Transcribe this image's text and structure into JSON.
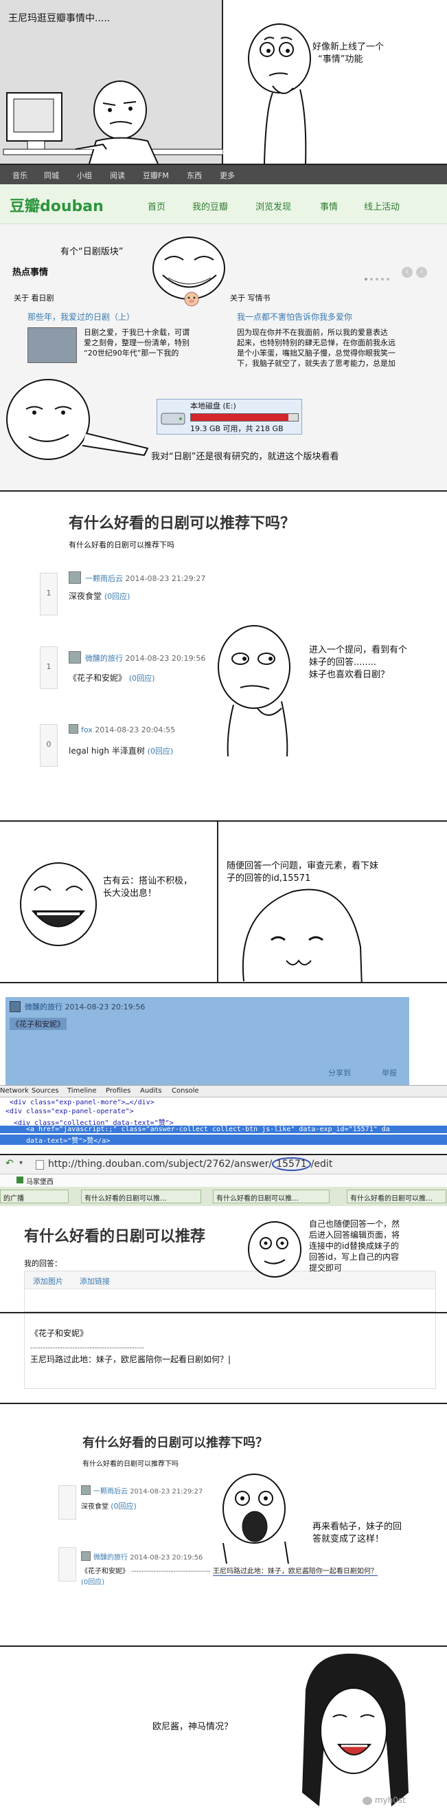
{
  "panel1": {
    "caption": "王尼玛逛豆瓣事情中.....",
    "thought": [
      "好像新上线了一个",
      "“事情”功能"
    ]
  },
  "douban": {
    "topnav": [
      "音乐",
      "同城",
      "小组",
      "阅读",
      "豆瓣FM",
      "东西",
      "更多"
    ],
    "logo": "豆瓣douban",
    "mainnav": [
      "首页",
      "我的豆瓣",
      "浏览发现",
      "事情",
      "线上活动"
    ],
    "bubble": "有个“日剧版块”",
    "hot_title": "热点事情",
    "left_tag": "关于 看日剧",
    "left_title": "那些年，我爱过的日剧（上）",
    "left_body": [
      "日剧之爱，于我已十余载，可谓",
      "爱之刻骨，整理一份清单，特别",
      "“20世纪90年代”那一下我的"
    ],
    "right_tag": "关于 写情书",
    "right_title": "我一点都不害怕告诉你我多爱你",
    "right_body": [
      "因为现在你并不在我面前，所以我的爱意表达",
      "起来，也特别特别的肆无忌惮，在你面前我永远",
      "是个小笨蛋，嘴拙又脑子慢，总觉得你眼我笑一",
      "下，我脑子就空了，就失去了思考能力，总是加"
    ],
    "disk_label": "本地磁盘 (E:)",
    "disk_info": "19.3 GB 可用，共 218 GB",
    "disk_fill_pct": 91,
    "speech": "我对“日剧”还是很有研究的，就进这个版块看看"
  },
  "question": {
    "title": "有什么好看的日剧可以推荐下吗？",
    "subtitle": "有什么好看的日剧可以推荐下吗",
    "answers": [
      {
        "votes": "1",
        "user": "一颗雨后云",
        "time": "2014-08-23 21:29:27",
        "text": "深夜食堂",
        "reply": "(0回应)"
      },
      {
        "votes": "1",
        "user": "微醺的旅行",
        "time": "2014-08-23 20:19:56",
        "text": "《花子和安妮》",
        "reply": "(0回应)"
      },
      {
        "votes": "0",
        "user": "fox",
        "time": "2014-08-23 20:04:55",
        "text": "legal high 半泽直树",
        "reply": "(0回应)"
      }
    ],
    "thought": [
      "进入一个提问，看到有个",
      "妹子的回答........",
      "妹子也喜欢看日剧？"
    ]
  },
  "panel4": {
    "left_caption": [
      "古有云：搭讪不积极，",
      "长大没出息！"
    ],
    "right_caption": [
      "随便回答一个问题，审查元素，看下妹",
      "子的回答的id,15571"
    ]
  },
  "inspect": {
    "user": "微醺的旅行",
    "time": "2014-08-23 20:19:56",
    "answer": "《花子和安妮》",
    "share": "分享到",
    "flag": "举报",
    "devtabs": [
      "Network",
      "Sources",
      "Timeline",
      "Profiles",
      "Audits",
      "Console"
    ],
    "code_lines": [
      "<div class=\"exp-panel-more\">…</div>",
      "<div class=\"exp-panel-operate\">",
      "<div class=\"collection\" data-text=\"赞\">",
      "<a href=\"javascript:;\" class=\"answer-collect collect-btn js-like\" data-exp_id=\"15571\" da",
      "data-text=\"赞\">赞</a>"
    ]
  },
  "edit": {
    "url_prefix": "http://thing.douban.com/subject/2762/answer/",
    "url_id": "15571",
    "url_suffix": "/edit",
    "fav": "马家堡西",
    "tabs": [
      "的广播",
      "有什么好看的日剧可以推…",
      "有什么好看的日剧可以推…",
      "有什么好看的日剧可以推…"
    ],
    "page_title": "有什么好看的日剧可以推荐",
    "my_answer": "我的回答：",
    "add_image": "添加图片",
    "add_link": "添加链接",
    "editor_line1": "《花子和安妮》",
    "editor_line2": "----------------------------------------------",
    "editor_line3": "王尼玛路过此地：妹子，欧尼酱陪你一起看日剧如何？|",
    "thought": [
      "自己也随便回答一个，然",
      "后进入回答编辑页面，将",
      "连接中的id替换成妹子的",
      "回答id，写上自己的内容",
      "提交即可"
    ]
  },
  "result": {
    "title": "有什么好看的日剧可以推荐下吗？",
    "subtitle": "有什么好看的日剧可以推荐下吗",
    "a1_user": "一颗雨后云",
    "a1_time": "2014-08-23 21:29:27",
    "a1_text": "深夜食堂",
    "a1_reply": "(0回应)",
    "a2_user": "微醺的旅行",
    "a2_time": "2014-08-23 20:19:56",
    "a2_text": "《花子和安妮》",
    "a2_sep": "--------------------------------",
    "a2_append": "王尼玛路过此地：妹子，欧尼酱陪你一起看日剧如何？",
    "a2_reply": "(0回应)",
    "caption": [
      "再来看帖子，妹子的回",
      "答就变成了这样！"
    ]
  },
  "final": {
    "caption": "欧尼酱，神马情况？",
    "watermark": "myh0st"
  }
}
